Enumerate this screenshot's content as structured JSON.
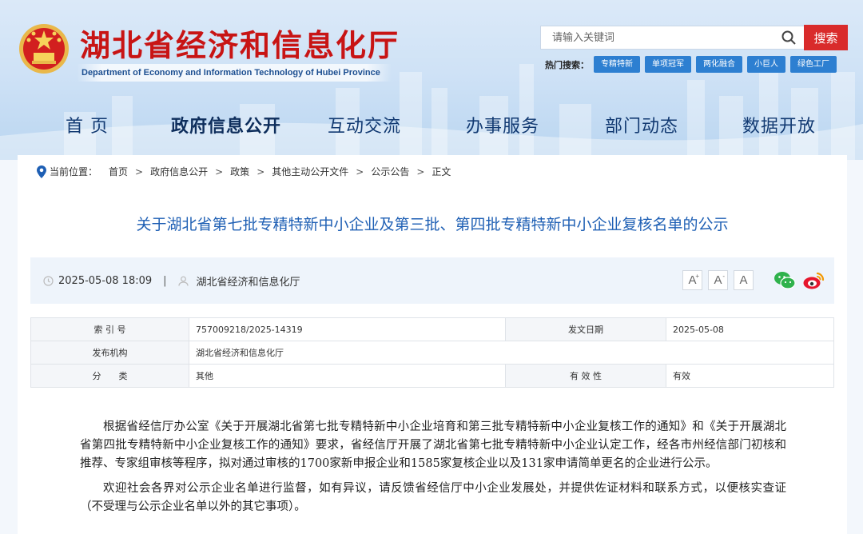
{
  "header": {
    "site_title": "湖北省经济和信息化厅",
    "site_subtitle": "Department of Economy and Information Technology of Hubei Province",
    "search": {
      "placeholder": "请输入关键词",
      "button_label": "搜索"
    },
    "hot_search": {
      "label": "热门搜索：",
      "tags": [
        "专精特新",
        "单项冠军",
        "两化融合",
        "小巨人",
        "绿色工厂"
      ]
    },
    "emblem_icon": "national-emblem-icon"
  },
  "nav": {
    "items": [
      "首 页",
      "政府信息公开",
      "互动交流",
      "办事服务",
      "部门动态",
      "数据开放"
    ],
    "active": "政府信息公开"
  },
  "breadcrumb": {
    "label": "当前位置：",
    "items": [
      "首页",
      "政府信息公开",
      "政策",
      "其他主动公开文件",
      "公示公告",
      "正文"
    ],
    "separator": ">"
  },
  "article": {
    "title": "关于湖北省第七批专精特新中小企业及第三批、第四批专精特新中小企业复核名单的公示",
    "meta": {
      "datetime": "2025-05-08 18:09",
      "divider": "|",
      "publisher": "湖北省经济和信息化厅",
      "font_buttons": [
        "A",
        "A",
        "A"
      ],
      "font_button_marks": [
        "+",
        "-",
        ""
      ],
      "share_icons": [
        "wechat-icon",
        "weibo-icon"
      ]
    },
    "info_table": {
      "index_label": "索 引 号",
      "index_value": "757009218/2025-14319",
      "date_label": "发文日期",
      "date_value": "2025-05-08",
      "org_label": "发布机构",
      "org_value": "湖北省经济和信息化厅",
      "category_label": "分　　类",
      "category_value": "其他",
      "validity_label": "有 效 性",
      "validity_value": "有效"
    },
    "paragraphs": [
      "根据省经信厅办公室《关于开展湖北省第七批专精特新中小企业培育和第三批专精特新中小企业复核工作的通知》和《关于开展湖北省第四批专精特新中小企业复核工作的通知》要求，省经信厅开展了湖北省第七批专精特新中小企业认定工作，经各市州经信部门初核和推荐、专家组审核等程序，拟对通过审核的1700家新申报企业和1585家复核企业以及131家申请简单更名的企业进行公示。",
      "欢迎社会各界对公示企业名单进行监督，如有异议，请反馈省经信厅中小企业发展处，并提供佐证材料和联系方式，以便核实查证（不受理与公示企业名单以外的其它事项）。"
    ]
  },
  "colors": {
    "title_red": "#c81414",
    "nav_blue": "#123a72",
    "article_title_blue": "#1e5fb4",
    "hot_tag_blue": "#2d7fd1",
    "search_red": "#d92b2b"
  }
}
